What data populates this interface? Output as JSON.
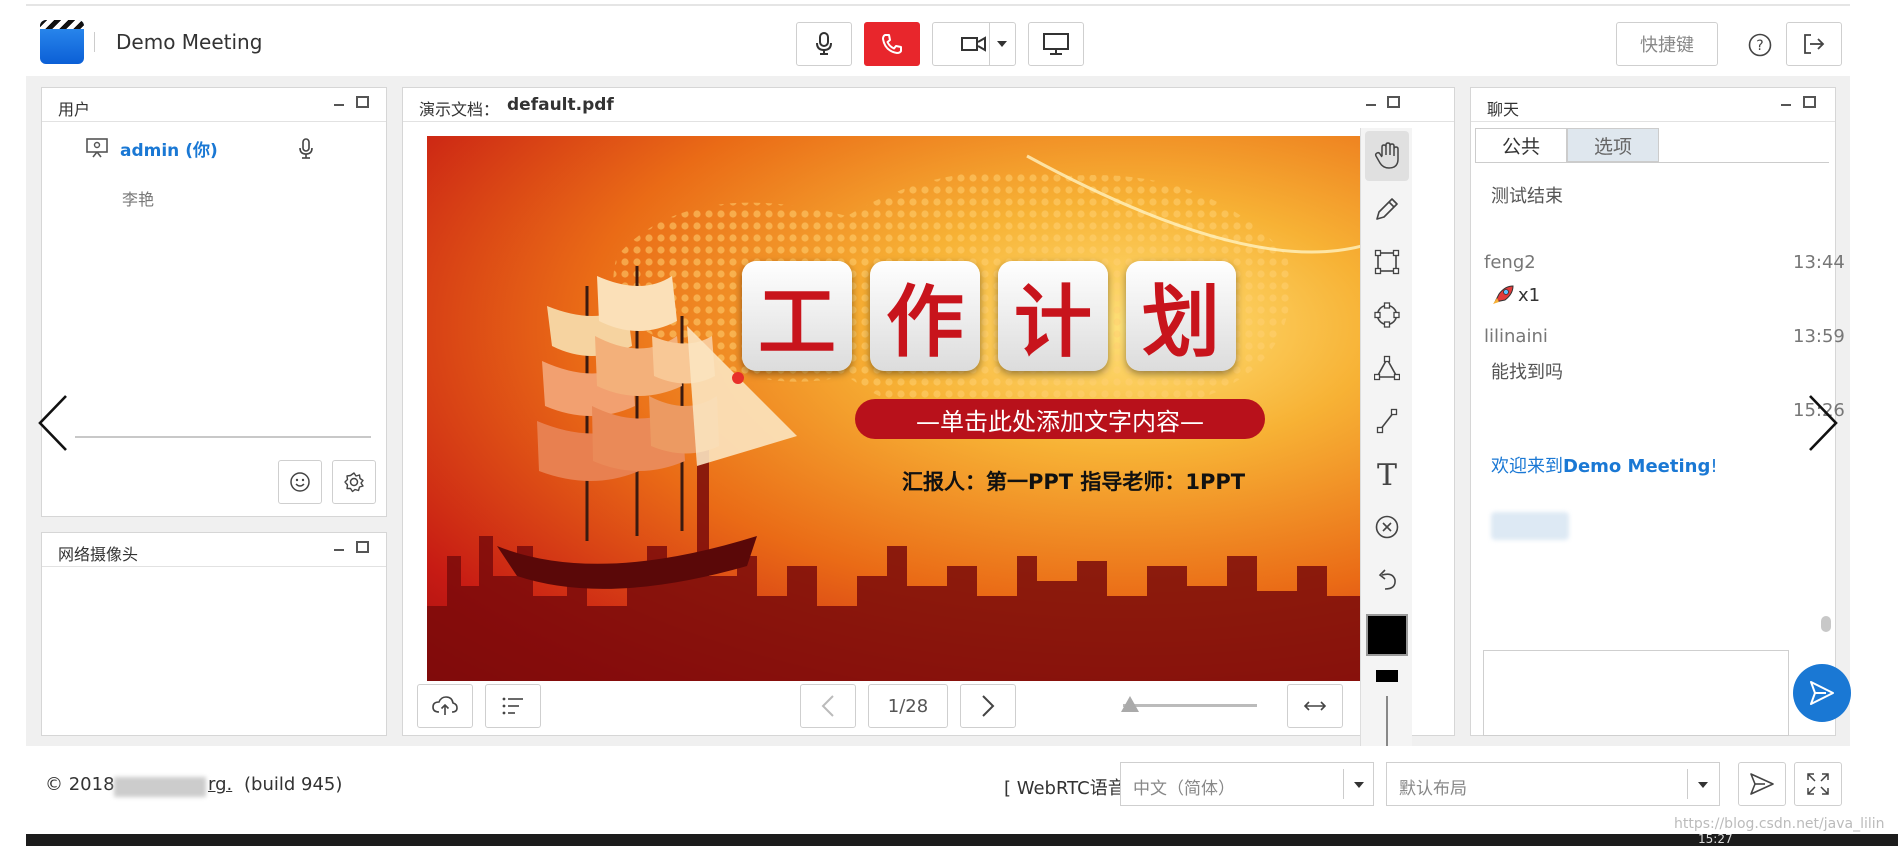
{
  "header": {
    "meeting_title": "Demo Meeting",
    "hotkey_label": "快捷键"
  },
  "users_panel": {
    "title": "用户",
    "users": [
      {
        "name": "admin (你)"
      },
      {
        "name": "李艳"
      }
    ]
  },
  "webcam_panel": {
    "title": "网络摄像头"
  },
  "presentation": {
    "title_prefix": "演示文档：",
    "file_name": "default.pdf",
    "page_indicator": "1/28",
    "slide": {
      "chars": [
        "工",
        "作",
        "计",
        "划"
      ],
      "subtitle": "—单击此处添加文字内容—",
      "reporter": "汇报人：第一PPT   指导老师：1PPT"
    }
  },
  "chat_panel": {
    "title": "聊天",
    "tabs": [
      "公共",
      "选项"
    ],
    "messages": [
      {
        "text": "测试结束"
      },
      {
        "name": "feng2",
        "time": "13:44",
        "text": "x1"
      },
      {
        "name": "lilinaini",
        "time": "13:59",
        "text": "能找到吗"
      },
      {
        "time": "15:26"
      }
    ],
    "welcome_prefix": "欢迎来到",
    "welcome_name": "Demo Meeting",
    "welcome_suffix": "!"
  },
  "footer": {
    "copyright_prefix": "© 2018",
    "copyright_domain_end": "rg.",
    "build": "(build 945)",
    "webrtc": "[ WebRTC语音 ]",
    "language": "中文（简体）",
    "layout": "默认布局"
  },
  "watermark": "https://blog.csdn.net/java_lilin",
  "clock": "15:27",
  "colors": {
    "accent_blue": "#1a78d4",
    "hangup_red": "#e8262c",
    "stage_gray": "#f0f0f0"
  },
  "icons": [
    "logo-icon",
    "microphone-icon",
    "phone-icon",
    "camera-icon",
    "screen-share-icon",
    "help-icon",
    "logout-icon",
    "presenter-icon",
    "emoji-icon",
    "settings-icon",
    "upload-icon",
    "list-icon",
    "hand-icon",
    "pencil-icon",
    "rectangle-icon",
    "ellipse-icon",
    "triangle-icon",
    "line-icon",
    "text-icon",
    "clear-icon",
    "undo-icon",
    "send-icon",
    "fullscreen-icon"
  ]
}
